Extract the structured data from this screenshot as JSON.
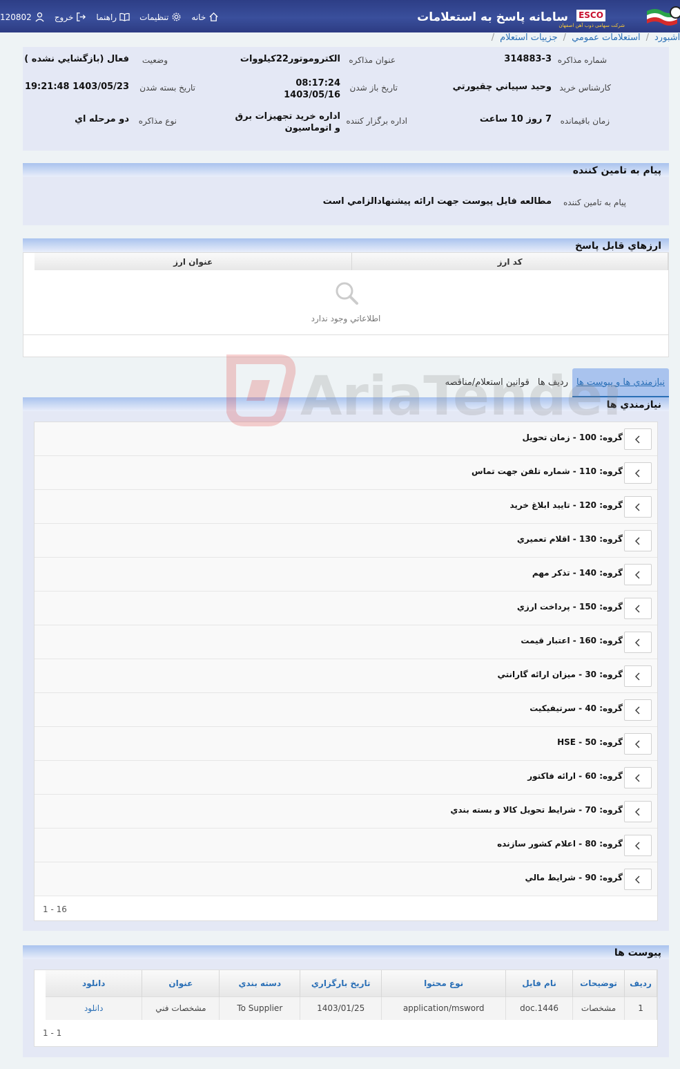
{
  "header": {
    "app_title": "سامانه پاسخ به استعلامات",
    "brand": "ESCO",
    "brand_sub": "شرکت سهامی ذوب آهن اصفهان",
    "nav": {
      "home": "خانه",
      "settings": "تنظيمات",
      "guide": "راهنما",
      "logout": "خروج",
      "user": "120802"
    }
  },
  "breadcrumb": [
    "داشبورد",
    "استعلامات عمومي",
    "جزييات استعلام"
  ],
  "info": {
    "number_label": "شماره مذاکره",
    "number_value": "314883-3",
    "title_label": "عنوان مذاکره",
    "title_value": "الكتروموتور22كيلووات",
    "status_label": "وضعيت",
    "status_value": "فعال (بازگشايي نشده )",
    "buyer_label": "كارشناس خريد",
    "buyer_value": "وحيد سپياني چقيورتي",
    "open_date_label": "تاريخ باز شدن",
    "open_time": "08:17:24",
    "open_date": "1403/05/16",
    "close_date_label": "تاريخ بسته شدن",
    "close_value": "1403/05/23 19:21:48",
    "remaining_label": "زمان باقيمانده",
    "remaining_value": "7 روز 10 ساعت",
    "org_label": "اداره برگزار کننده",
    "org_value_line1": "اداره خريد تجهيزات برق",
    "org_value_line2": "و اتوماسيون",
    "type_label": "نوع مذاکره",
    "type_value": "دو مرحله اي"
  },
  "supplier_message": {
    "title": "پيام به تامين کننده",
    "label": "پيام به تامين کننده",
    "value": "مطالعه فايل پيوست جهت ارائه پيشنهادالزامي است"
  },
  "currencies": {
    "title": "ارزهاي قابل پاسخ",
    "col_code": "کد ارز",
    "col_title": "عنوان ارز",
    "empty": "اطلاعاتي وجود ندارد"
  },
  "tabs": [
    "نيازمندي ها و پيوست ها",
    "رديف ها",
    "قوانين استعلام/مناقصه"
  ],
  "requirements": {
    "title": "نيازمندي ها",
    "groups": [
      "گروه: 100 - زمان تحويل",
      "گروه: 110 - شماره تلفن جهت تماس",
      "گروه: 120 - تاييد ابلاغ خريد",
      "گروه: 130 - اقلام تعميري",
      "گروه: 140 - تذکر مهم",
      "گروه: 150 - پرداخت ارزي",
      "گروه: 160 - اعتبار قيمت",
      "گروه: 30 - ميزان ارائه گارانتي",
      "گروه: 40 - سرتيفيکيت",
      "گروه: 50 - HSE",
      "گروه: 60 - ارائه فاكتور",
      "گروه: 70 - شرايط تحويل کالا و بسته بندي",
      "گروه: 80 - اعلام كشور سازنده",
      "گروه: 90 - شرايط مالي"
    ],
    "pager": "1 - 16"
  },
  "attachments": {
    "title": "پيوست ها",
    "columns": [
      "رديف",
      "توضيحات",
      "نام فايل",
      "نوع محتوا",
      "تاريخ بارگزاري",
      "دسته بندي",
      "عنوان",
      "دانلود"
    ],
    "rows": [
      [
        "1",
        "مشخصات",
        "doc.1446",
        "application/msword",
        "1403/01/25",
        "To Supplier",
        "مشخصات فني",
        "دانلود"
      ]
    ],
    "pager": "1 - 1"
  },
  "watermark": "AriaTender.neT"
}
